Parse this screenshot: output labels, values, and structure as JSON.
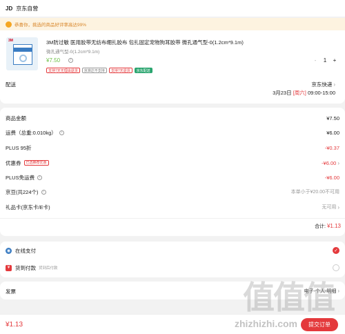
{
  "header": {
    "logo": "JD",
    "store": "京东自营"
  },
  "notice": {
    "text": "恭喜你，挑选的商品好评率高达99%"
  },
  "product": {
    "title": "3M防过敏 医用胶带无纺布绷扎胶布 包扎固定宠物狗耳胶带 微孔通气型-0(1.2cm*9.1m)",
    "spec": "微孔通气型-0(1.2cm*9.1m)",
    "price": "¥7.50",
    "qty": "1",
    "minus": "-",
    "plus": "+",
    "image_brand": "3M",
    "tags": [
      "支持7天无理由退货",
      "京准达不支持",
      "支持7天退货",
      "京东配送"
    ]
  },
  "delivery": {
    "label": "配送",
    "carrier": "京东快递",
    "date": "3月23日",
    "weekday": "[周六]",
    "slot": "09:00-15:00"
  },
  "summary": {
    "rows": [
      {
        "label": "商品金额",
        "value": "¥7.50"
      },
      {
        "label": "运费（总重:0.010kg）",
        "value": "¥6.00"
      },
      {
        "label": "PLUS 95折",
        "value": "-¥0.37"
      },
      {
        "label": "优惠券",
        "tag": "已选推荐优惠",
        "value": "-¥6.00"
      },
      {
        "label": "PLUS免运费",
        "value": "-¥6.00"
      },
      {
        "label": "京豆(共224个)",
        "value": "本单小于¥20.00不可用"
      },
      {
        "label": "礼品卡(京东卡/E卡)",
        "value": "无可用"
      }
    ],
    "subtotal_label": "合计:",
    "subtotal_value": "¥1.13"
  },
  "payment": {
    "options": [
      {
        "label": "在线支付",
        "desc": "",
        "color": "#3a7cc2",
        "selected": true
      },
      {
        "label": "货到付款",
        "desc": "货到后付款",
        "color": "#e4393c",
        "selected": false
      }
    ]
  },
  "invoice": {
    "label": "发票",
    "value": "电子-个人-明细"
  },
  "footer": {
    "total": "¥1.13",
    "submit": "提交订单"
  },
  "watermark": {
    "text": "值值值",
    "url": "zhizhizhi.com"
  },
  "colors": {
    "accent": "#e4393c",
    "price_green": "#6bbf44",
    "notice_bg": "#fdf3e0"
  }
}
